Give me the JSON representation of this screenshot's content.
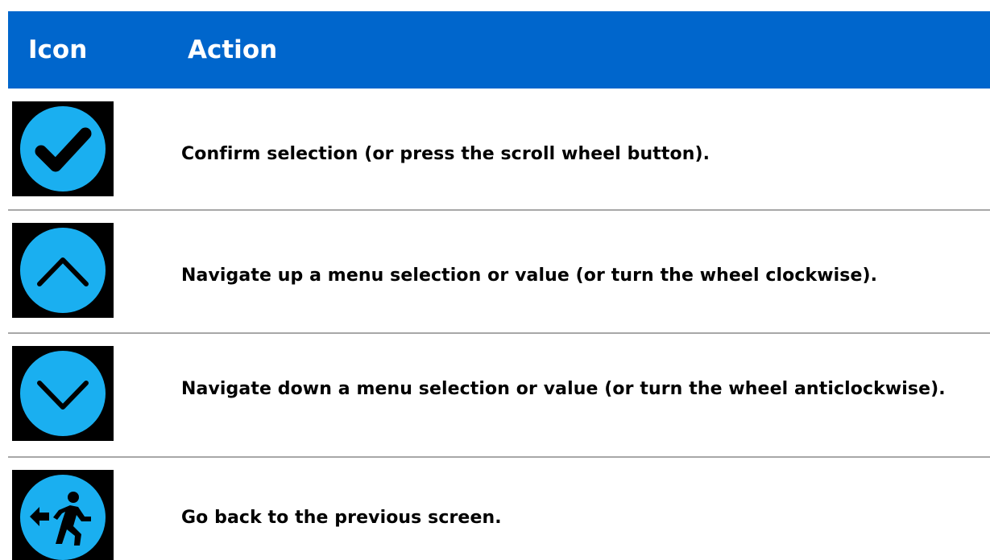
{
  "header": {
    "icon_label": "Icon",
    "action_label": "Action"
  },
  "rows": [
    {
      "icon": "checkmark-icon",
      "action": "Confirm selection (or press the scroll wheel button)."
    },
    {
      "icon": "chevron-up-icon",
      "action": "Navigate up a menu selection or value (or turn the wheel clockwise)."
    },
    {
      "icon": "chevron-down-icon",
      "action": "Navigate down a menu selection or value (or turn the wheel anticlockwise)."
    },
    {
      "icon": "exit-back-icon",
      "action": "Go back to the previous screen."
    }
  ],
  "colors": {
    "header_bg": "#0066cc",
    "header_text": "#ffffff",
    "icon_circle": "#1aaff0",
    "icon_bg": "#000000",
    "divider": "#a8a8a8"
  }
}
